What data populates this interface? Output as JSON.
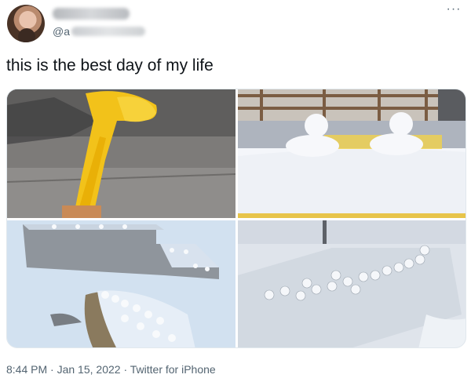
{
  "author": {
    "handle_prefix": "@a"
  },
  "tweet": {
    "text": "this is the best day of my life"
  },
  "media": {
    "count": 4
  },
  "meta": {
    "time": "8:44 PM",
    "separator": "·",
    "date": "Jan 15, 2022",
    "source": "Twitter for iPhone"
  },
  "icons": {
    "more": "more-horizontal-icon"
  }
}
